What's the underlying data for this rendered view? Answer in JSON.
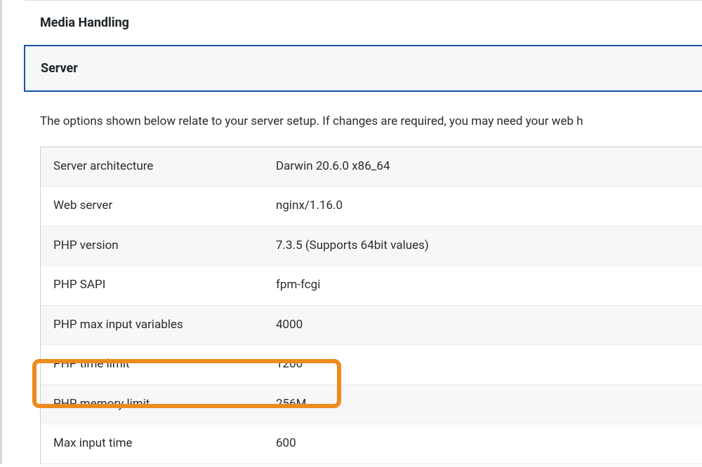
{
  "panels": {
    "media": {
      "title": "Media Handling"
    },
    "server": {
      "title": "Server"
    }
  },
  "description": "The options shown below relate to your server setup. If changes are required, you may need your web h",
  "rows": [
    {
      "label": "Server architecture",
      "value": "Darwin 20.6.0 x86_64"
    },
    {
      "label": "Web server",
      "value": "nginx/1.16.0"
    },
    {
      "label": "PHP version",
      "value": "7.3.5 (Supports 64bit values)"
    },
    {
      "label": "PHP SAPI",
      "value": "fpm-fcgi"
    },
    {
      "label": "PHP max input variables",
      "value": "4000"
    },
    {
      "label": "PHP time limit",
      "value": "1200"
    },
    {
      "label": "PHP memory limit",
      "value": "256M"
    },
    {
      "label": "Max input time",
      "value": "600"
    }
  ]
}
